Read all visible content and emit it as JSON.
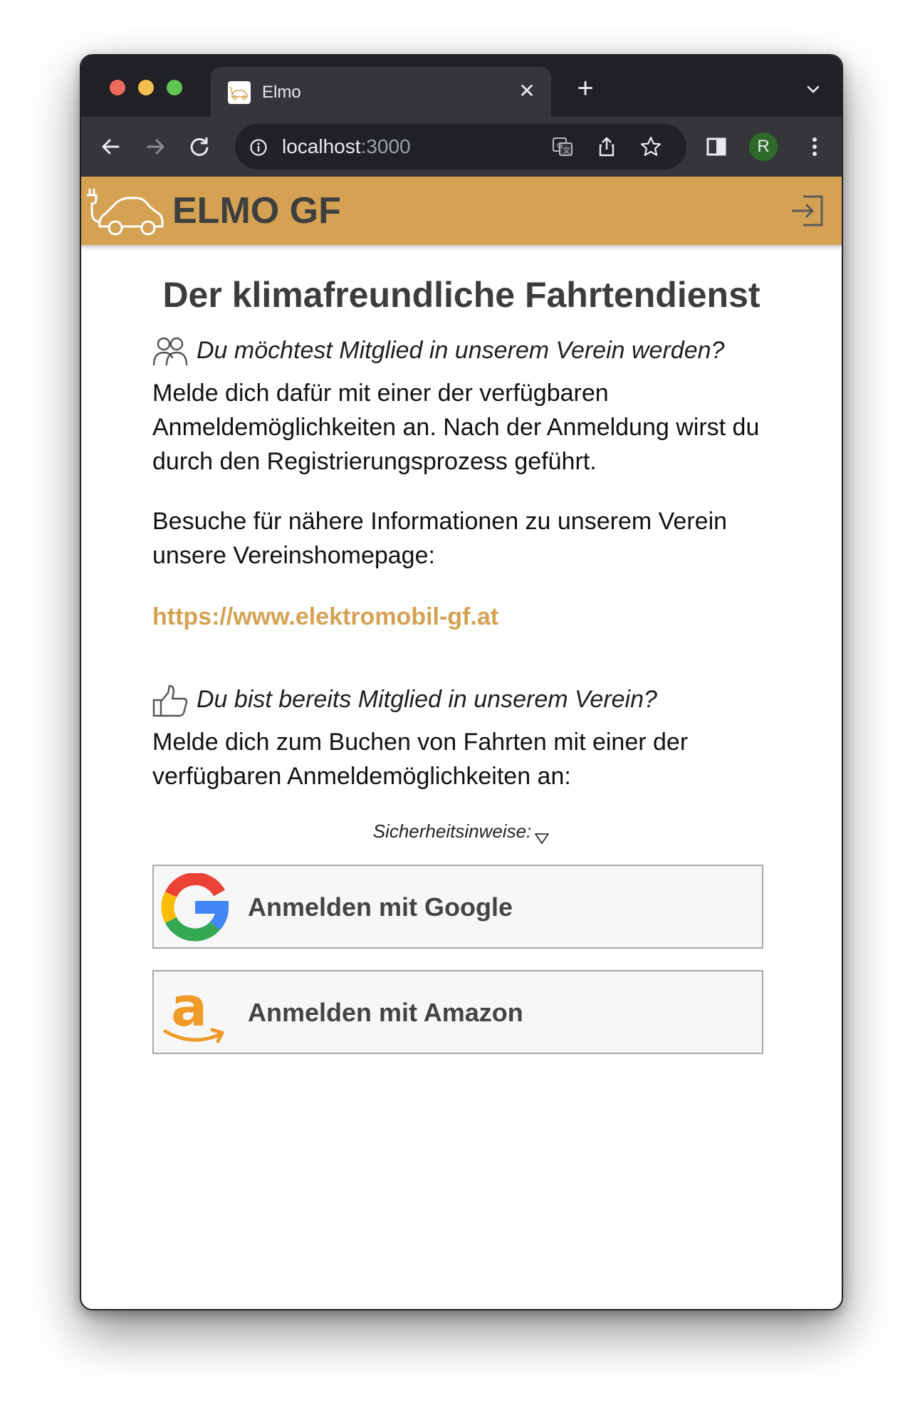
{
  "browser": {
    "tab_title": "Elmo",
    "url_host": "localhost",
    "url_port": ":3000",
    "avatar_initial": "R",
    "colors": {
      "frame": "#202124",
      "toolbar": "#35363a"
    }
  },
  "header": {
    "title": "ELMO GF",
    "background": "#d5a253"
  },
  "main": {
    "title": "Der klimafreundliche Fahrtendienst",
    "join_question": "Du möchtest Mitglied in unserem Verein werden?",
    "join_text": "Melde dich dafür mit einer der verfügbaren Anmeldemöglichkeiten an. Nach der Anmeldung wirst du durch den Registrierungsprozess geführt.",
    "info_text": "Besuche für nähere Informationen zu unserem Verein unsere Vereinshomepage:",
    "homepage_link": "https://www.elektromobil-gf.at",
    "member_question": "Du bist bereits Mitglied in unserem Verein?",
    "member_text": "Melde dich zum Buchen von Fahrten mit einer der verfügbaren Anmeldemöglichkeiten an:",
    "security_hint": "Sicherheitsinweise:",
    "google_button": "Anmelden mit Google",
    "amazon_button": "Anmelden mit Amazon",
    "icons": [
      "people-icon",
      "thumbs-up-icon",
      "google-logo-icon",
      "amazon-logo-icon",
      "login-icon",
      "car-plug-logo-icon"
    ]
  }
}
